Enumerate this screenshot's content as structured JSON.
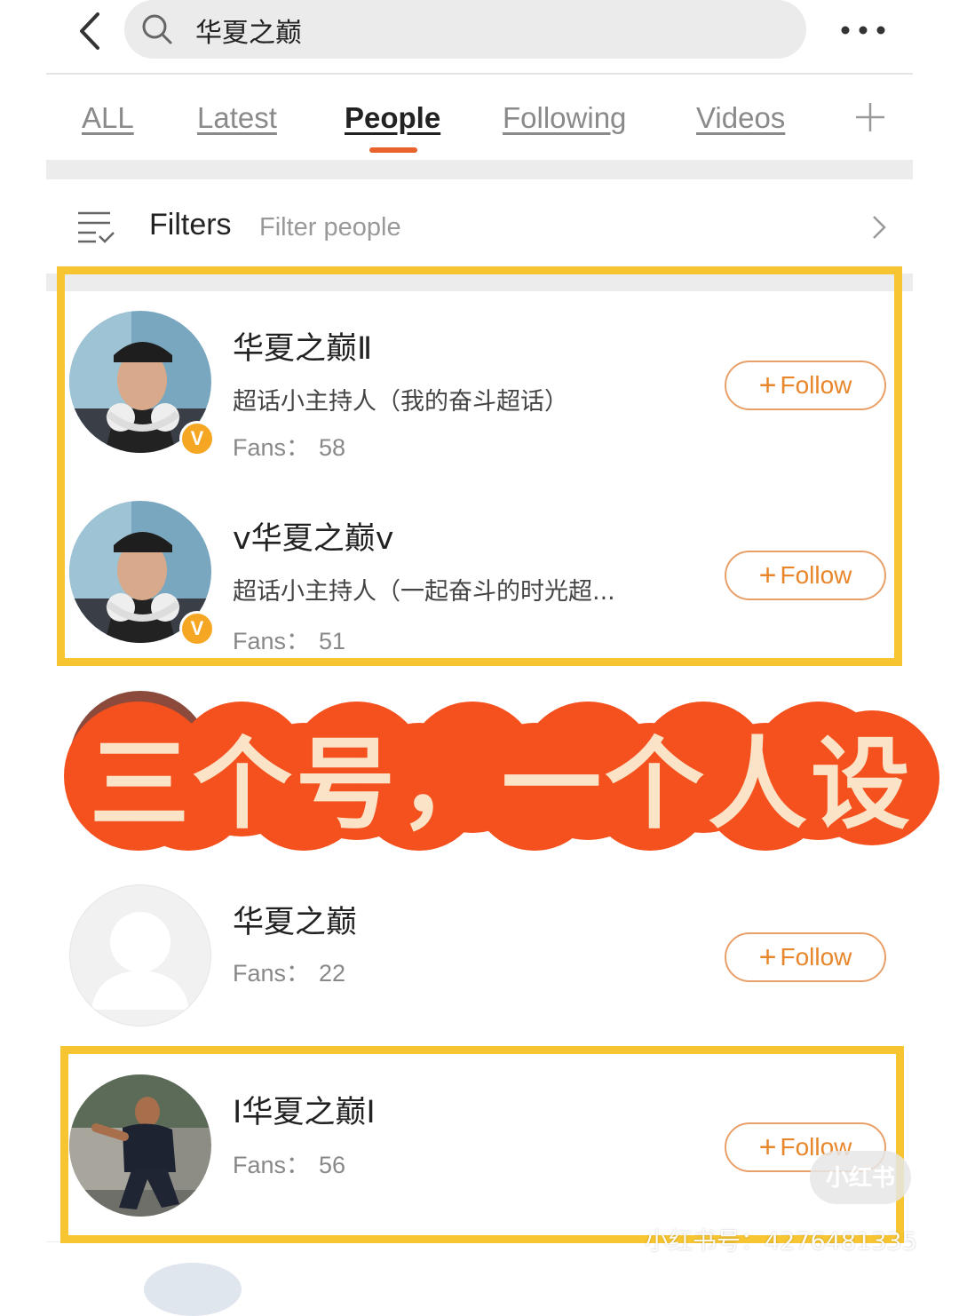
{
  "search": {
    "query": "华夏之巅"
  },
  "tabs": [
    {
      "label": "ALL"
    },
    {
      "label": "Latest"
    },
    {
      "label": "People"
    },
    {
      "label": "Following"
    },
    {
      "label": "Videos"
    }
  ],
  "active_tab": "People",
  "filters": {
    "label": "Filters",
    "placeholder": "Filter people"
  },
  "follow_label": "Follow",
  "users": [
    {
      "name": "华夏之巅Ⅱ",
      "desc": "超话小主持人（我的奋斗超话）",
      "fans_label": "Fans：",
      "fans": "58",
      "verified": "V"
    },
    {
      "name": "v华夏之巅v",
      "desc": "超话小主持人（一起奋斗的时光超...",
      "fans_label": "Fans：",
      "fans": "51",
      "verified": "V"
    },
    {
      "name": "华夏之巅",
      "fans_label": "Fans：",
      "fans": "22"
    },
    {
      "name": "I华夏之巅I",
      "fans_label": "Fans：",
      "fans": "56"
    }
  ],
  "banner": {
    "text": "三个号，一个人设"
  },
  "watermark": {
    "logo": "小红书",
    "text": "小红书号：4276481335"
  },
  "colors": {
    "accent": "#e8622b",
    "highlight": "#f7c531",
    "banner": "#f4511e",
    "follow": "#e8862b"
  }
}
